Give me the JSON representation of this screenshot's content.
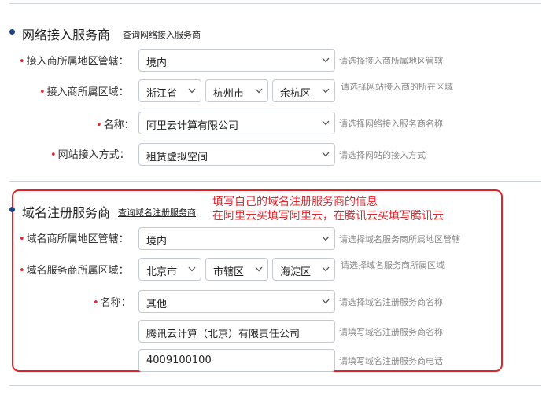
{
  "network_section": {
    "title": "网络接入服务商",
    "query_link": "查询网络接入服务商",
    "rows": {
      "region_mgmt": {
        "label": "接入商所属地区管辖：",
        "value": "境内",
        "hint": "请选择接入商所属地区管辖"
      },
      "region": {
        "label": "接入商所属区域：",
        "province": "浙江省",
        "city": "杭州市",
        "district": "余杭区",
        "hint": "请选择网站接入商的所在区域"
      },
      "name": {
        "label": "名称：",
        "value": "阿里云计算有限公司",
        "hint": "请选择网络接入服务商名称"
      },
      "access_method": {
        "label": "网站接入方式：",
        "value": "租赁虚拟空间",
        "hint": "请选择网站的接入方式"
      }
    }
  },
  "domain_section": {
    "title": "域名注册服务商",
    "query_link": "查询域名注册服务商",
    "rows": {
      "region_mgmt": {
        "label": "域名商所属地区管辖：",
        "value": "境内",
        "hint": "请选择域名服务商所属地区管辖"
      },
      "region": {
        "label": "域名服务商所属区域：",
        "province": "北京市",
        "city": "市辖区",
        "district": "海淀区",
        "hint": "请选择域名服务商所属区域"
      },
      "name": {
        "label": "名称：",
        "value": "其他",
        "hint": "请选择域名注册服务商名称"
      },
      "name_text": {
        "value": "腾讯云计算（北京）有限责任公司",
        "hint": "请填写域名注册服务商名称"
      },
      "phone": {
        "value": "4009100100",
        "hint": "请填写域名注册服务商电话"
      }
    }
  },
  "annotation": {
    "line1": "填写自己的域名注册服务商的信息",
    "line2": "在阿里云买填写阿里云，在腾讯云买填写腾讯云",
    "color": "#e0242c"
  },
  "colors": {
    "bullet": "#1f3f86",
    "border": "#c5c9d1",
    "hint": "#888888",
    "required": "#e0242c"
  },
  "icons": {
    "chevron": "chevron-down-icon"
  }
}
